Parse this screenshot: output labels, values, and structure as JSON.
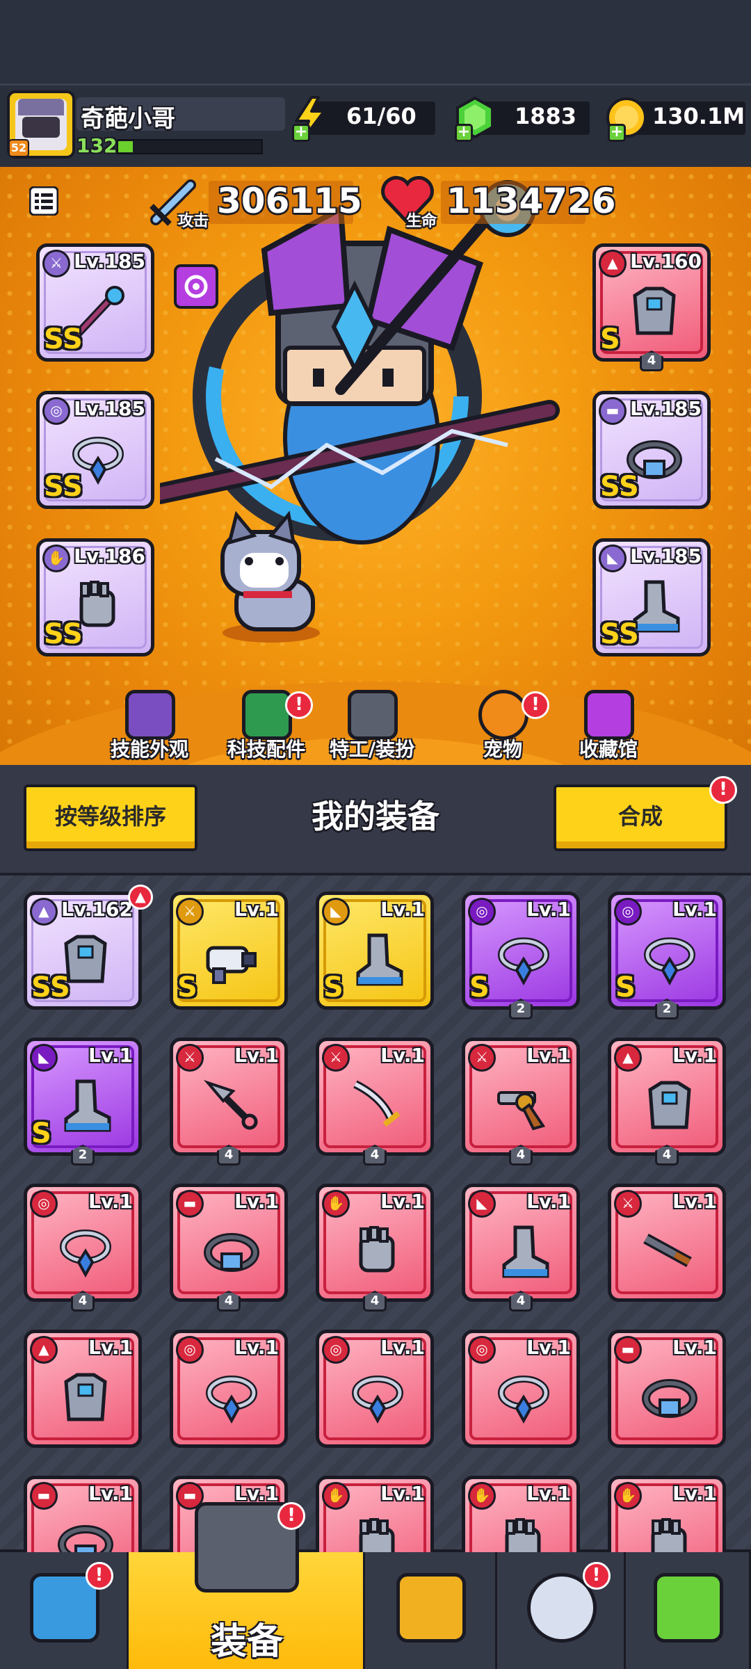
{
  "header": {
    "player_name": "奇葩小哥",
    "level": "132",
    "vip": "52",
    "xp_progress": 0.1,
    "energy": "61/60",
    "gems": "1883",
    "coins": "130.1M"
  },
  "hero": {
    "attack_label": "攻击",
    "attack_value": "306115",
    "hp_label": "生命",
    "hp_value": "1134726",
    "menu_icon": "list-icon",
    "equipped_left": [
      {
        "level": "Lv.185",
        "grade": "SS",
        "type": "weapon",
        "icon": "staff-icon"
      },
      {
        "level": "Lv.185",
        "grade": "SS",
        "type": "necklace",
        "icon": "necklace-icon"
      },
      {
        "level": "Lv.186",
        "grade": "SS",
        "type": "glove",
        "icon": "gauntlet-icon"
      }
    ],
    "equipped_right": [
      {
        "level": "Lv.160",
        "grade": "S",
        "type": "armor",
        "icon": "armor-icon",
        "stars": "4"
      },
      {
        "level": "Lv.185",
        "grade": "SS",
        "type": "belt",
        "icon": "belt-icon"
      },
      {
        "level": "Lv.185",
        "grade": "SS",
        "type": "boots",
        "icon": "boots-icon"
      }
    ]
  },
  "feature_menu": [
    {
      "label": "技能外观",
      "icon": "skin-icon",
      "alert": false
    },
    {
      "label": "科技配件",
      "icon": "tech-icon",
      "alert": true
    },
    {
      "label": "特工/装扮",
      "icon": "agent-icon",
      "alert": false
    },
    {
      "label": "宠物",
      "icon": "pet-icon",
      "alert": true
    },
    {
      "label": "收藏馆",
      "icon": "collection-icon",
      "alert": false
    }
  ],
  "toolbar": {
    "sort_label": "按等级排序",
    "title": "我的装备",
    "merge_label": "合成"
  },
  "inventory": [
    {
      "level": "Lv.162",
      "rarity": "purple",
      "grade": "SS",
      "type": "armor",
      "icon": "armor-icon",
      "stars": "",
      "alert": true
    },
    {
      "level": "Lv.1",
      "rarity": "yellow",
      "grade": "S",
      "type": "weapon",
      "icon": "blaster-icon",
      "stars": ""
    },
    {
      "level": "Lv.1",
      "rarity": "yellow",
      "grade": "S",
      "type": "boots",
      "icon": "boots-icon",
      "stars": ""
    },
    {
      "level": "Lv.1",
      "rarity": "violet",
      "grade": "S",
      "type": "necklace",
      "icon": "necklace-icon",
      "stars": "2"
    },
    {
      "level": "Lv.1",
      "rarity": "violet",
      "grade": "S",
      "type": "necklace",
      "icon": "necklace-icon",
      "stars": "2"
    },
    {
      "level": "Lv.1",
      "rarity": "violet",
      "grade": "S",
      "type": "boots",
      "icon": "boots-icon",
      "stars": "2"
    },
    {
      "level": "Lv.1",
      "rarity": "red",
      "grade": "",
      "type": "weapon",
      "icon": "kunai-icon",
      "stars": "4"
    },
    {
      "level": "Lv.1",
      "rarity": "red",
      "grade": "",
      "type": "weapon",
      "icon": "sword-icon",
      "stars": "4"
    },
    {
      "level": "Lv.1",
      "rarity": "red",
      "grade": "",
      "type": "weapon",
      "icon": "revolver-icon",
      "stars": "4"
    },
    {
      "level": "Lv.1",
      "rarity": "red",
      "grade": "",
      "type": "armor",
      "icon": "armor-icon",
      "stars": "4"
    },
    {
      "level": "Lv.1",
      "rarity": "red",
      "grade": "",
      "type": "necklace",
      "icon": "necklace-icon",
      "stars": "4"
    },
    {
      "level": "Lv.1",
      "rarity": "red",
      "grade": "",
      "type": "belt",
      "icon": "belt-icon",
      "stars": "4"
    },
    {
      "level": "Lv.1",
      "rarity": "red",
      "grade": "",
      "type": "glove",
      "icon": "gauntlet-icon",
      "stars": "4"
    },
    {
      "level": "Lv.1",
      "rarity": "red",
      "grade": "",
      "type": "boots",
      "icon": "boots-icon",
      "stars": "4"
    },
    {
      "level": "Lv.1",
      "rarity": "red",
      "grade": "",
      "type": "weapon",
      "icon": "shotgun-icon",
      "stars": ""
    },
    {
      "level": "Lv.1",
      "rarity": "red",
      "grade": "",
      "type": "armor",
      "icon": "armor-icon",
      "stars": ""
    },
    {
      "level": "Lv.1",
      "rarity": "red",
      "grade": "",
      "type": "necklace",
      "icon": "necklace-icon",
      "stars": ""
    },
    {
      "level": "Lv.1",
      "rarity": "red",
      "grade": "",
      "type": "necklace",
      "icon": "necklace-icon",
      "stars": ""
    },
    {
      "level": "Lv.1",
      "rarity": "red",
      "grade": "",
      "type": "necklace",
      "icon": "necklace-icon",
      "stars": ""
    },
    {
      "level": "Lv.1",
      "rarity": "red",
      "grade": "",
      "type": "belt",
      "icon": "belt-icon",
      "stars": ""
    },
    {
      "level": "Lv.1",
      "rarity": "red",
      "grade": "",
      "type": "belt",
      "icon": "belt-icon",
      "stars": ""
    },
    {
      "level": "Lv.1",
      "rarity": "red",
      "grade": "",
      "type": "belt",
      "icon": "belt-icon",
      "stars": ""
    },
    {
      "level": "Lv.1",
      "rarity": "red",
      "grade": "",
      "type": "glove",
      "icon": "gauntlet-icon",
      "stars": ""
    },
    {
      "level": "Lv.1",
      "rarity": "red",
      "grade": "",
      "type": "glove",
      "icon": "gauntlet-icon",
      "stars": ""
    },
    {
      "level": "Lv.1",
      "rarity": "red",
      "grade": "",
      "type": "glove",
      "icon": "gauntlet-icon",
      "stars": ""
    }
  ],
  "bottom_nav": [
    {
      "label": "",
      "icon": "shop-icon",
      "alert": true,
      "active": false
    },
    {
      "label": "装备",
      "icon": "equipment-icon",
      "alert": true,
      "active": true
    },
    {
      "label": "",
      "icon": "battle-star-icon",
      "alert": false,
      "active": false
    },
    {
      "label": "",
      "icon": "gacha-ball-icon",
      "alert": true,
      "active": false
    },
    {
      "label": "",
      "icon": "dna-icon",
      "alert": false,
      "active": false
    }
  ],
  "colors": {
    "rarity_red": "#f05a78",
    "rarity_purple": "#cfb3f5",
    "rarity_yellow": "#f5c413",
    "rarity_violet": "#9b37e2",
    "accent_yellow": "#ffd21a",
    "hero_bg": "#f39a10"
  }
}
